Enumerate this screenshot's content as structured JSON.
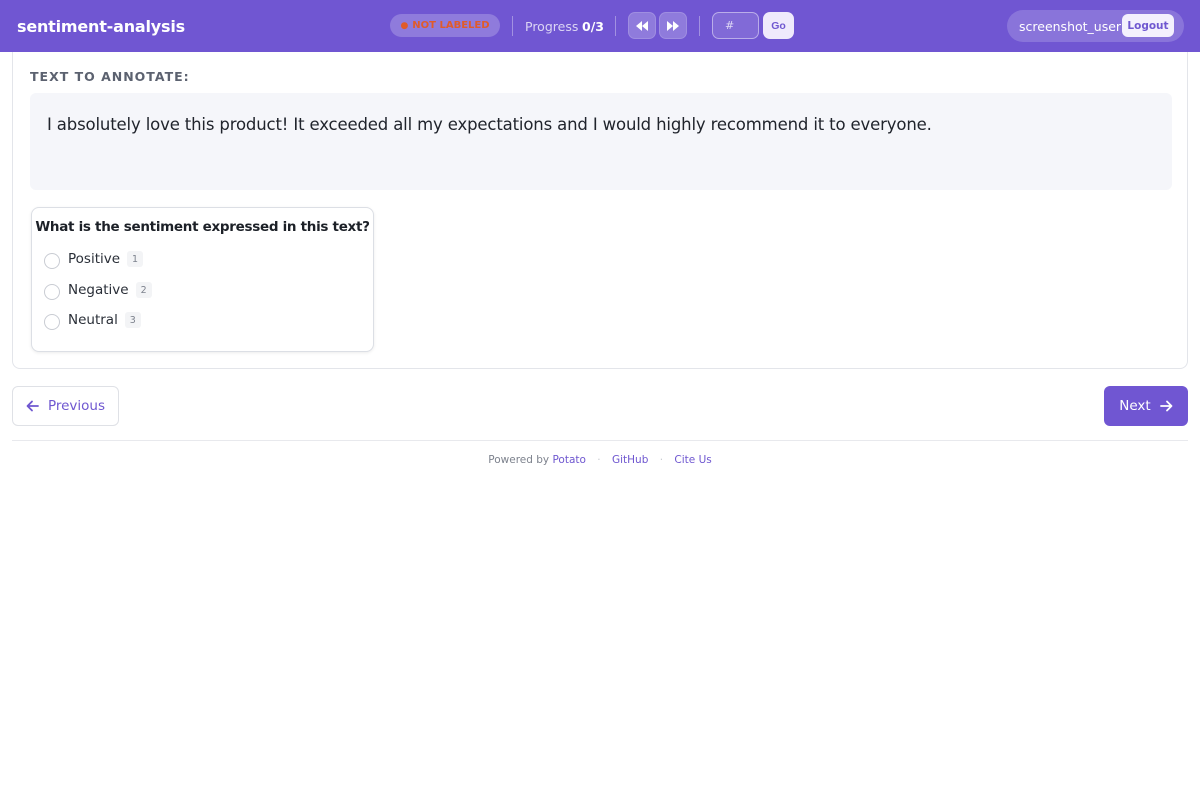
{
  "header": {
    "app_title": "sentiment-analysis",
    "status_label": "NOT LABELED",
    "progress_label": "Progress",
    "progress_value": "0/3",
    "goto_placeholder": "#",
    "go_label": "Go",
    "username": "screenshot_user",
    "logout_label": "Logout",
    "accent_color": "#7056d2",
    "status_color": "#e05b2a"
  },
  "annotation": {
    "section_label": "TEXT TO ANNOTATE:",
    "text": "I absolutely love this product! It exceeded all my expectations and I would highly recommend it to everyone.",
    "question": "What is the sentiment expressed in this text?",
    "options": [
      {
        "label": "Positive",
        "key": "1"
      },
      {
        "label": "Negative",
        "key": "2"
      },
      {
        "label": "Neutral",
        "key": "3"
      }
    ]
  },
  "navigation": {
    "previous_label": "Previous",
    "next_label": "Next"
  },
  "footer": {
    "powered_by": "Powered by",
    "potato": "Potato",
    "github": "GitHub",
    "cite": "Cite Us"
  }
}
